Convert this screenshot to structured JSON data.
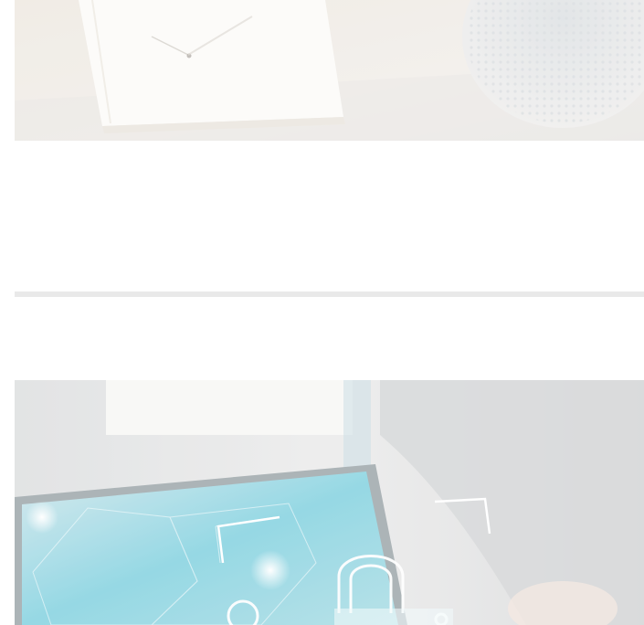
{
  "articles": [
    {
      "image": {
        "subject": "notebook-with-pen-on-desk",
        "tone": "faded-warm"
      }
    },
    {
      "image": {
        "subject": "laptop-with-padlock-security-overlay",
        "tone": "faded-cyan"
      }
    }
  ],
  "colors": {
    "background": "#ffffff",
    "divider": "#e9e9e9",
    "accent_cyan": "#6fd3e3"
  }
}
